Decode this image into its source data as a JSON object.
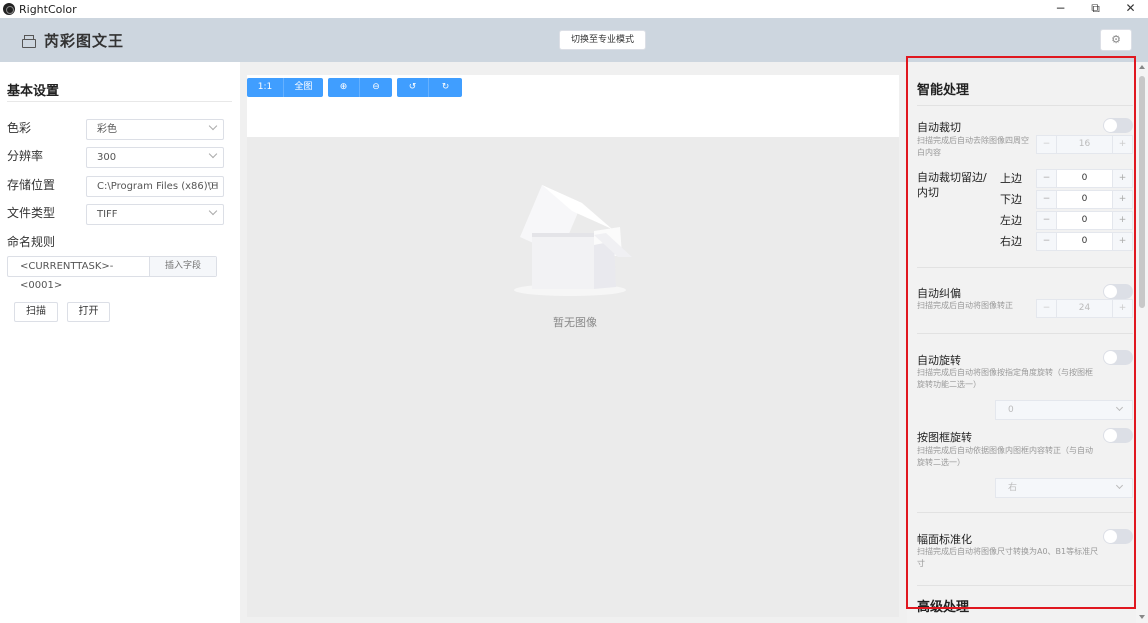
{
  "window": {
    "title": "RightColor",
    "minimize": "−",
    "restore": "⧉",
    "close": "✕"
  },
  "header": {
    "app_name": "芮彩图文王",
    "pro_mode_button": "切换至专业模式",
    "settings_icon": "gear-icon"
  },
  "basic_settings": {
    "title": "基本设置",
    "color_label": "色彩",
    "color_value": "彩色",
    "resolution_label": "分辨率",
    "resolution_value": "300",
    "storage_label": "存储位置",
    "storage_value": "C:\\Program Files (x86)\\H",
    "filetype_label": "文件类型",
    "filetype_value": "TIFF",
    "naming_label": "命名规则",
    "naming_value": "<CURRENTTASK>-<0001>",
    "insert_field": "插入字段",
    "scan_button": "扫描",
    "open_button": "打开"
  },
  "toolbar": {
    "one_to_one": "1:1",
    "fit_all": "全图",
    "zoom_in": "⊕",
    "zoom_out": "⊖",
    "rotate_left": "↺",
    "rotate_right": "↻"
  },
  "canvas": {
    "empty_text": "暂无图像"
  },
  "smart_processing": {
    "title": "智能处理",
    "auto_crop": {
      "label": "自动裁切",
      "desc": "扫描完成后自动去除图像四周空白内容",
      "value": "16",
      "minus": "−",
      "plus": "+"
    },
    "crop_margin": {
      "label": "自动裁切留边/内切",
      "top_label": "上边",
      "top_value": "0",
      "bottom_label": "下边",
      "bottom_value": "0",
      "left_label": "左边",
      "left_value": "0",
      "right_label": "右边",
      "right_value": "0",
      "minus": "−",
      "plus": "+"
    },
    "deskew": {
      "label": "自动纠偏",
      "desc": "扫描完成后自动将图像转正",
      "value": "24"
    },
    "auto_rotate": {
      "label": "自动旋转",
      "desc": "扫描完成后自动将图像按指定角度旋转（与按图框旋转功能二选一）",
      "value": "0"
    },
    "frame_rotate": {
      "label": "按图框旋转",
      "desc": "扫描完成后自动依据图像内图框内容转正（与自动旋转二选一）",
      "value": "右"
    },
    "standardize": {
      "label": "幅面标准化",
      "desc": "扫描完成后自动将图像尺寸转换为A0、B1等标准尺寸"
    }
  },
  "advanced_processing": {
    "title": "高级处理"
  }
}
